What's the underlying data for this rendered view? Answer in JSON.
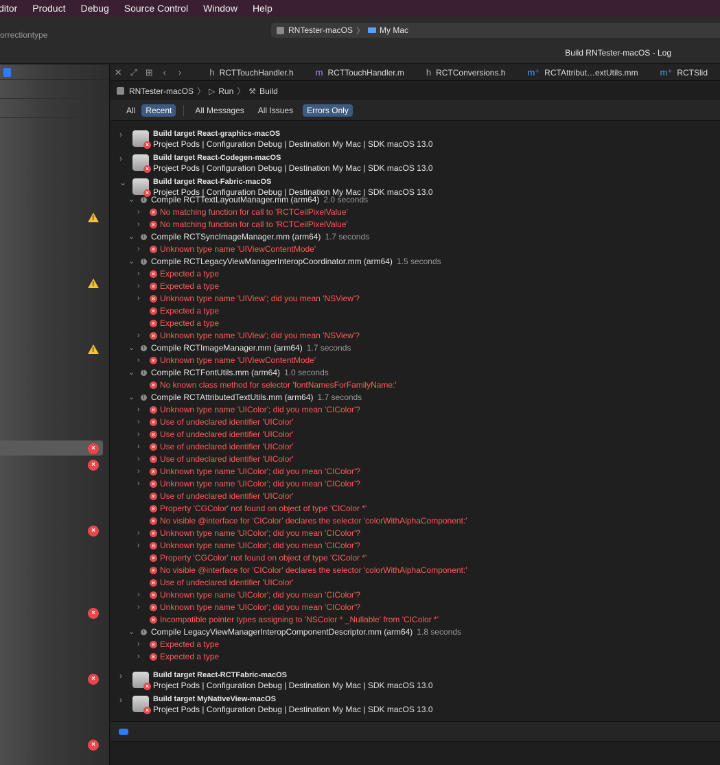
{
  "menubar": [
    "ditor",
    "Product",
    "Debug",
    "Source Control",
    "Window",
    "Help"
  ],
  "toolbar": {
    "left_text": "orrectiontype",
    "scheme": "RNTester-macOS",
    "destination": "My Mac",
    "status": "Build RNTester-macOS - Log"
  },
  "tabs": [
    {
      "kind": "h",
      "name": "RCTTouchHandler.h"
    },
    {
      "kind": "m",
      "name": "RCTTouchHandler.m"
    },
    {
      "kind": "h",
      "name": "RCTConversions.h"
    },
    {
      "kind": "mm",
      "name": "RCTAttribut…extUtils.mm"
    },
    {
      "kind": "mm",
      "name": "RCTSlid"
    }
  ],
  "jumpbar": {
    "project": "RNTester-macOS",
    "action": "Run",
    "phase": "Build"
  },
  "filters": {
    "scope": [
      "All",
      "Recent"
    ],
    "scope_selected": "Recent",
    "kinds": [
      "All Messages",
      "All Issues",
      "Errors Only"
    ],
    "kind_selected": "Errors Only"
  },
  "log": [
    {
      "type": "target",
      "title": "Build target React-graphics-macOS",
      "detail": "Project Pods | Configuration Debug | Destination My Mac | SDK macOS 13.0",
      "expanded": false
    },
    {
      "type": "target",
      "title": "Build target React-Codegen-macOS",
      "detail": "Project Pods | Configuration Debug | Destination My Mac | SDK macOS 13.0",
      "expanded": false
    },
    {
      "type": "target",
      "title": "Build target React-Fabric-macOS",
      "detail": "Project Pods | Configuration Debug | Destination My Mac | SDK macOS 13.0",
      "expanded": true
    },
    {
      "type": "compile",
      "label": "Compile RCTTextLayoutManager.mm (arm64)",
      "duration": "2.0 seconds"
    },
    {
      "type": "error",
      "label": "No matching function for call to 'RCTCeilPixelValue'",
      "chevron": true
    },
    {
      "type": "error",
      "label": "No matching function for call to 'RCTCeilPixelValue'",
      "chevron": true
    },
    {
      "type": "compile",
      "label": "Compile RCTSyncImageManager.mm (arm64)",
      "duration": "1.7 seconds"
    },
    {
      "type": "error",
      "label": "Unknown type name 'UIViewContentMode'",
      "chevron": true
    },
    {
      "type": "compile",
      "label": "Compile RCTLegacyViewManagerInteropCoordinator.mm (arm64)",
      "duration": "1.5 seconds"
    },
    {
      "type": "error",
      "label": "Expected a type",
      "chevron": true
    },
    {
      "type": "error",
      "label": "Expected a type",
      "chevron": true
    },
    {
      "type": "error",
      "label": "Unknown type name 'UIView'; did you mean 'NSView'?",
      "chevron": true
    },
    {
      "type": "error",
      "label": "Expected a type",
      "chevron": false
    },
    {
      "type": "error",
      "label": "Expected a type",
      "chevron": false
    },
    {
      "type": "error",
      "label": "Unknown type name 'UIView'; did you mean 'NSView'?",
      "chevron": true
    },
    {
      "type": "compile",
      "label": "Compile RCTImageManager.mm (arm64)",
      "duration": "1.7 seconds"
    },
    {
      "type": "error",
      "label": "Unknown type name 'UIViewContentMode'",
      "chevron": true
    },
    {
      "type": "compile",
      "label": "Compile RCTFontUtils.mm (arm64)",
      "duration": "1.0 seconds"
    },
    {
      "type": "error",
      "label": "No known class method for selector 'fontNamesForFamilyName:'",
      "chevron": false
    },
    {
      "type": "compile",
      "label": "Compile RCTAttributedTextUtils.mm (arm64)",
      "duration": "1.7 seconds"
    },
    {
      "type": "error",
      "label": "Unknown type name 'UIColor'; did you mean 'CIColor'?",
      "chevron": true
    },
    {
      "type": "error",
      "label": "Use of undeclared identifier 'UIColor'",
      "chevron": true
    },
    {
      "type": "error",
      "label": "Use of undeclared identifier 'UIColor'",
      "chevron": true
    },
    {
      "type": "error",
      "label": "Use of undeclared identifier 'UIColor'",
      "chevron": true
    },
    {
      "type": "error",
      "label": "Use of undeclared identifier 'UIColor'",
      "chevron": true
    },
    {
      "type": "error",
      "label": "Unknown type name 'UIColor'; did you mean 'CIColor'?",
      "chevron": true
    },
    {
      "type": "error",
      "label": "Unknown type name 'UIColor'; did you mean 'CIColor'?",
      "chevron": true
    },
    {
      "type": "error",
      "label": "Use of undeclared identifier 'UIColor'",
      "chevron": false
    },
    {
      "type": "error",
      "label": "Property 'CGColor' not found on object of type 'CIColor *'",
      "chevron": false
    },
    {
      "type": "error",
      "label": "No visible @interface for 'CIColor' declares the selector 'colorWithAlphaComponent:'",
      "chevron": false
    },
    {
      "type": "error",
      "label": "Unknown type name 'UIColor'; did you mean 'CIColor'?",
      "chevron": true
    },
    {
      "type": "error",
      "label": "Unknown type name 'UIColor'; did you mean 'CIColor'?",
      "chevron": true
    },
    {
      "type": "error",
      "label": "Property 'CGColor' not found on object of type 'CIColor *'",
      "chevron": false
    },
    {
      "type": "error",
      "label": "No visible @interface for 'CIColor' declares the selector 'colorWithAlphaComponent:'",
      "chevron": false
    },
    {
      "type": "error",
      "label": "Use of undeclared identifier 'UIColor'",
      "chevron": false
    },
    {
      "type": "error",
      "label": "Unknown type name 'UIColor'; did you mean 'CIColor'?",
      "chevron": true
    },
    {
      "type": "error",
      "label": "Unknown type name 'UIColor'; did you mean 'CIColor'?",
      "chevron": true
    },
    {
      "type": "error",
      "label": "Incompatible pointer types assigning to 'NSColor * _Nullable' from 'CIColor *'",
      "chevron": false
    },
    {
      "type": "compile",
      "label": "Compile LegacyViewManagerInteropComponentDescriptor.mm (arm64)",
      "duration": "1.8 seconds"
    },
    {
      "type": "error",
      "label": "Expected a type",
      "chevron": true
    },
    {
      "type": "error",
      "label": "Expected a type",
      "chevron": true
    },
    {
      "type": "target",
      "title": "Build target React-RCTFabric-macOS",
      "detail": "Project Pods | Configuration Debug | Destination My Mac | SDK macOS 13.0",
      "expanded": false
    },
    {
      "type": "target",
      "title": "Build target MyNativeView-macOS",
      "detail": "Project Pods | Configuration Debug | Destination My Mac | SDK macOS 13.0",
      "expanded": false
    }
  ],
  "sidebar_markers": [
    "warning",
    "warning",
    "warning",
    "error",
    "error",
    "error",
    "error",
    "error",
    "error"
  ],
  "colors": {
    "error": "#ff5b58",
    "accent": "#2f7cf6",
    "warning": "#f6c230",
    "menubar": "#3a1f33"
  }
}
